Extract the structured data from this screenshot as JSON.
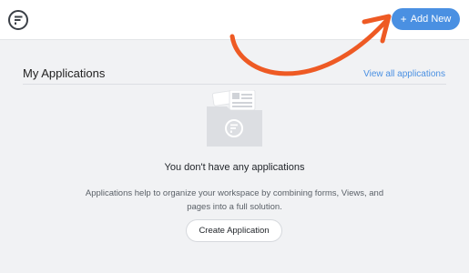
{
  "header": {
    "logo_icon": "formidable-logo-icon",
    "add_new_label": "Add New",
    "add_new_icon": "plus-icon"
  },
  "section": {
    "title": "My Applications",
    "view_all_link": "View all applications"
  },
  "empty_state": {
    "illustration_icon": "folder-with-documents-icon",
    "title": "You don't have any applications",
    "description": "Applications help to organize your workspace by combining forms, Views, and pages into a full solution.",
    "create_button_label": "Create Application"
  },
  "colors": {
    "accent": "#4a90e2",
    "annotation_arrow": "#ee5a24",
    "background": "#f1f2f4"
  }
}
